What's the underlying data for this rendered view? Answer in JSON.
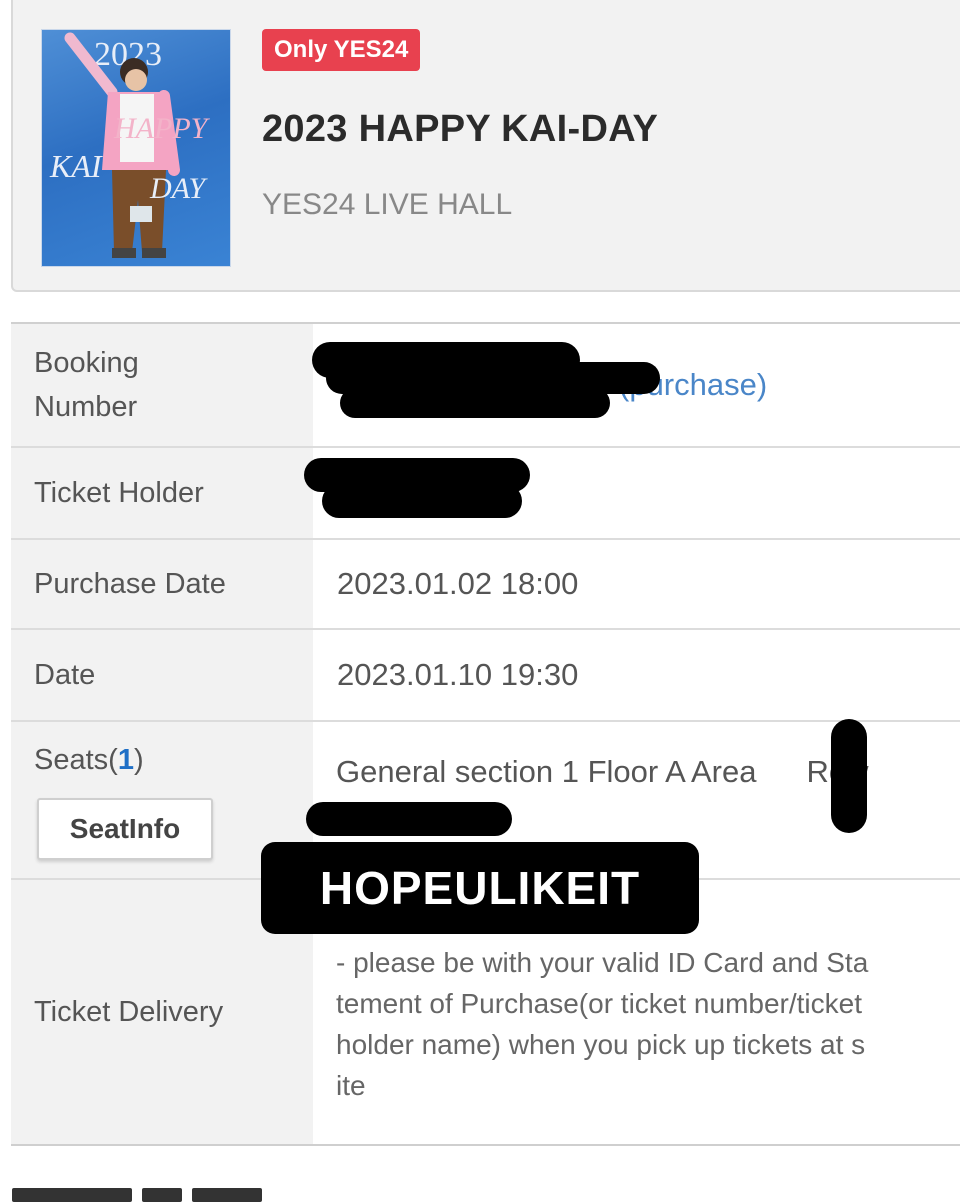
{
  "event": {
    "badge": "Only YES24",
    "title": "2023 HAPPY KAI-DAY",
    "venue": "YES24 LIVE HALL",
    "poster": {
      "year": "2023",
      "happy": "HAPPY",
      "kai": "KAI",
      "day": "DAY"
    }
  },
  "rows": {
    "booking": {
      "label": "Booking\nNumber",
      "suffix": "(purchase)"
    },
    "holder": {
      "label": "Ticket Holder"
    },
    "purchase_date": {
      "label": "Purchase Date",
      "value": "2023.01.02 18:00"
    },
    "date": {
      "label": "Date",
      "value": "2023.01.10 19:30"
    },
    "seats": {
      "label": "Seats(",
      "count": "1",
      "close": ")",
      "button": "SeatInfo",
      "value": "General section 1 Floor A Area",
      "value_end": "Row"
    },
    "delivery": {
      "label": "Ticket Delivery",
      "value": "- please be with your valid ID Card and Sta\ntement of Purchase(or ticket number/ticket\nholder name) when you pick up tickets at s\nite"
    }
  },
  "overlay": {
    "text": "HOPEULIKEIT"
  },
  "colors": {
    "badge": "#e8414f",
    "link": "#4a86c8",
    "seat_count": "#1f6fc6",
    "label_bg": "#f2f2f2"
  }
}
